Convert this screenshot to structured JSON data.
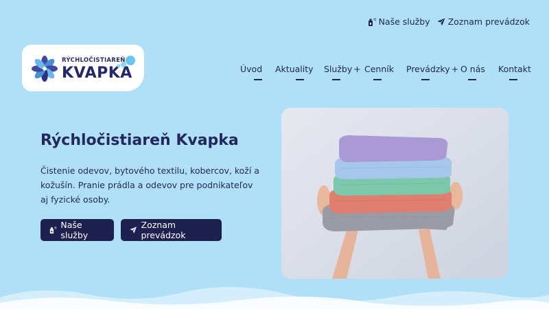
{
  "topbar": {
    "services_label": "Naše služby",
    "locations_label": "Zoznam prevádzok"
  },
  "logo": {
    "small_text": "RÝCHLOČISTIAREŇ",
    "big_text": "KVAPKA"
  },
  "nav": {
    "items": [
      {
        "label": "Úvod",
        "has_submenu": false
      },
      {
        "label": "Aktuality",
        "has_submenu": false
      },
      {
        "label": "Služby",
        "has_submenu": true
      },
      {
        "label": "Cenník",
        "has_submenu": false
      },
      {
        "label": "Prevádzky",
        "has_submenu": true
      },
      {
        "label": "O nás",
        "has_submenu": false
      },
      {
        "label": "Kontakt",
        "has_submenu": false
      }
    ],
    "plus": "+"
  },
  "hero": {
    "title": "Rýchločistiareň Kvapka",
    "text": "Čistenie odevov, bytového textilu, kobercov, koží a kožušín. Pranie prádla a odevov pre podnikateľov aj fyzické osoby.",
    "button_services": "Naše služby",
    "button_locations": "Zoznam prevádzok"
  },
  "icons": {
    "services": "spray-bottle-icon",
    "locations": "paper-plane-icon"
  },
  "colors": {
    "background": "#afe0f7",
    "primary": "#1e2150",
    "white": "#ffffff"
  }
}
